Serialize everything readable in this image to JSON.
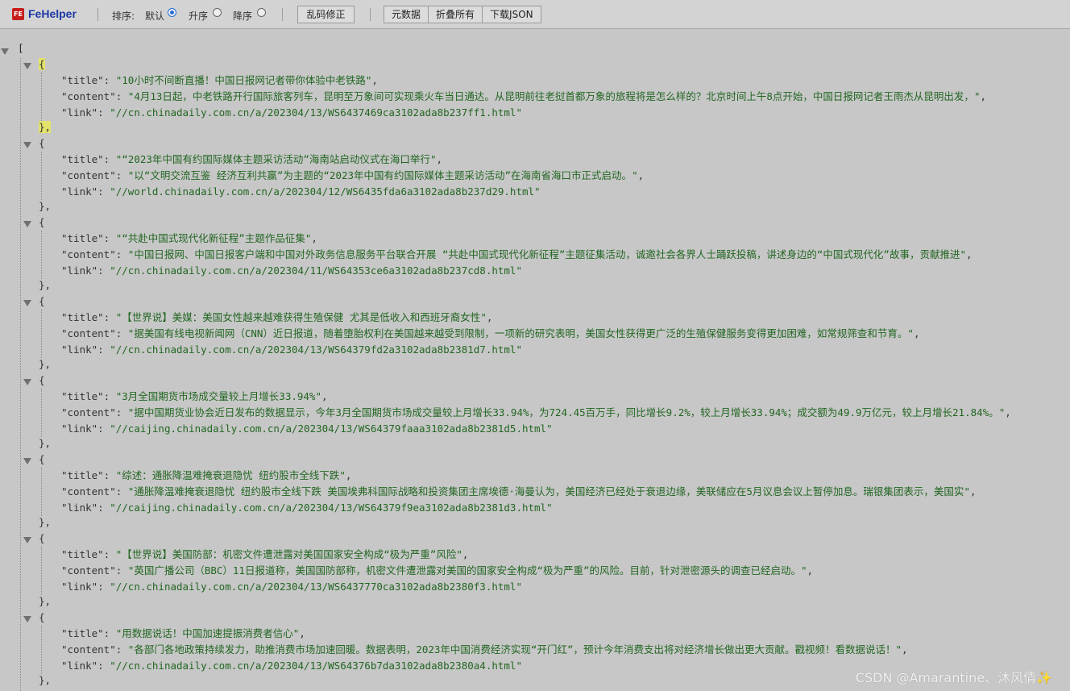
{
  "toolbar": {
    "brand": "FeHelper",
    "logo_text": "FE",
    "sort_label": "排序:",
    "sort_options": [
      {
        "label": "默认",
        "selected": true
      },
      {
        "label": "升序",
        "selected": false
      },
      {
        "label": "降序",
        "selected": false
      }
    ],
    "fix_button": "乱码修正",
    "raw_button": "元数据",
    "collapse_button": "折叠所有",
    "download_button": "下载JSON"
  },
  "json": {
    "open_bracket": "[",
    "items": [
      {
        "title": "10小时不间断直播！中国日报网记者带你体验中老铁路",
        "content": "4月13日起，中老铁路开行国际旅客列车，昆明至万象间可实现乘火车当日通达。从昆明前往老挝首都万象的旅程将是怎么样的？北京时间上午8点开始，中国日报网记者王雨杰从昆明出发，",
        "link": "//cn.chinadaily.com.cn/a/202304/13/WS6437469ca3102ada8b237ff1.html"
      },
      {
        "title": "“2023年中国有约国际媒体主题采访活动”海南站启动仪式在海口举行",
        "content": "以“文明交流互鉴 经济互利共赢”为主题的“2023年中国有约国际媒体主题采访活动”在海南省海口市正式启动。",
        "link": "//world.chinadaily.com.cn/a/202304/12/WS6435fda6a3102ada8b237d29.html"
      },
      {
        "title": "“共赴中国式现代化新征程”主题作品征集",
        "content": "中国日报网、中国日报客户端和中国对外政务信息服务平台联合开展 “共赴中国式现代化新征程”主题征集活动，诚邀社会各界人士踊跃投稿，讲述身边的“中国式现代化”故事，贡献推进",
        "link": "//cn.chinadaily.com.cn/a/202304/11/WS64353ce6a3102ada8b237cd8.html"
      },
      {
        "title": "【世界说】美媒：美国女性越来越难获得生殖保健 尤其是低收入和西班牙裔女性",
        "content": "据美国有线电视新闻网（CNN）近日报道，随着堕胎权利在美国越来越受到限制，一项新的研究表明，美国女性获得更广泛的生殖保健服务变得更加困难，如常规筛查和节育。",
        "link": "//cn.chinadaily.com.cn/a/202304/13/WS64379fd2a3102ada8b2381d7.html"
      },
      {
        "title": "3月全国期货市场成交量较上月增长33.94%",
        "content": "据中国期货业协会近日发布的数据显示，今年3月全国期货市场成交量较上月增长33.94%，为724.45百万手，同比增长9.2%，较上月增长33.94%；成交额为49.9万亿元，较上月增长21.84%。",
        "link": "//caijing.chinadaily.com.cn/a/202304/13/WS64379faaa3102ada8b2381d5.html"
      },
      {
        "title": "综述：通胀降温难掩衰退隐忧 纽约股市全线下跌",
        "content": "通胀降温难掩衰退隐忧 纽约股市全线下跌  美国埃弗科国际战略和投资集团主席埃德·海曼认为，美国经济已经处于衰退边缘，美联储应在5月议息会议上暂停加息。瑞银集团表示，美国实",
        "link": "//caijing.chinadaily.com.cn/a/202304/13/WS64379f9ea3102ada8b2381d3.html"
      },
      {
        "title": "【世界说】美国防部：机密文件遭泄露对美国国家安全构成“极为严重”风险",
        "content": "英国广播公司（BBC）11日报道称，美国国防部称，机密文件遭泄露对美国的国家安全构成“极为严重”的风险。目前，针对泄密源头的调查已经启动。",
        "link": "//cn.chinadaily.com.cn/a/202304/13/WS6437770ca3102ada8b2380f3.html"
      },
      {
        "title": "用数据说话！中国加速提振消费者信心",
        "content": "各部门各地政策持续发力，助推消费市场加速回暖。数据表明，2023年中国消费经济实现“开门红”，预计今年消费支出将对经济增长做出更大贡献。戳视频！看数据说话！",
        "link": "//cn.chinadaily.com.cn/a/202304/13/WS64376b7da3102ada8b2380a4.html"
      }
    ]
  },
  "watermark": "CSDN @Amarantine、沐风倩✨"
}
